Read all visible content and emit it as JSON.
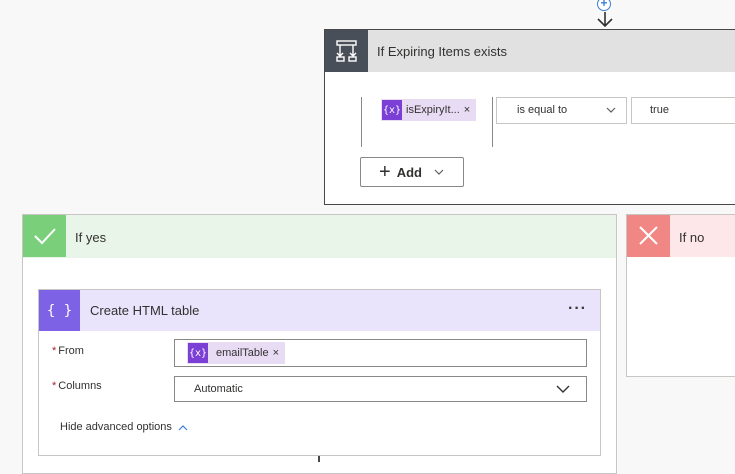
{
  "condition": {
    "title": "If Expiring Items exists",
    "operand_token": "isExpiryIt...",
    "token_icon": "{x}",
    "token_remove": "×",
    "operator": "is equal to",
    "value": "true",
    "add_label": "Add"
  },
  "yes_branch": {
    "title": "If yes"
  },
  "no_branch": {
    "title": "If no"
  },
  "action": {
    "icon": "{ }",
    "title": "Create HTML table",
    "more": "···",
    "from_label": "From",
    "from_token": "emailTable",
    "from_token_icon": "{x}",
    "from_token_remove": "×",
    "columns_label": "Columns",
    "columns_value": "Automatic",
    "required_mark": "*",
    "hide_advanced": "Hide advanced options"
  },
  "colors": {
    "condition_icon_bg": "#484f58",
    "yes_accent": "#7ad07a",
    "no_accent": "#f08784",
    "action_accent": "#7e62e6",
    "token_bg": "#e8dcf5",
    "token_icon_bg": "#7b3fd6"
  }
}
